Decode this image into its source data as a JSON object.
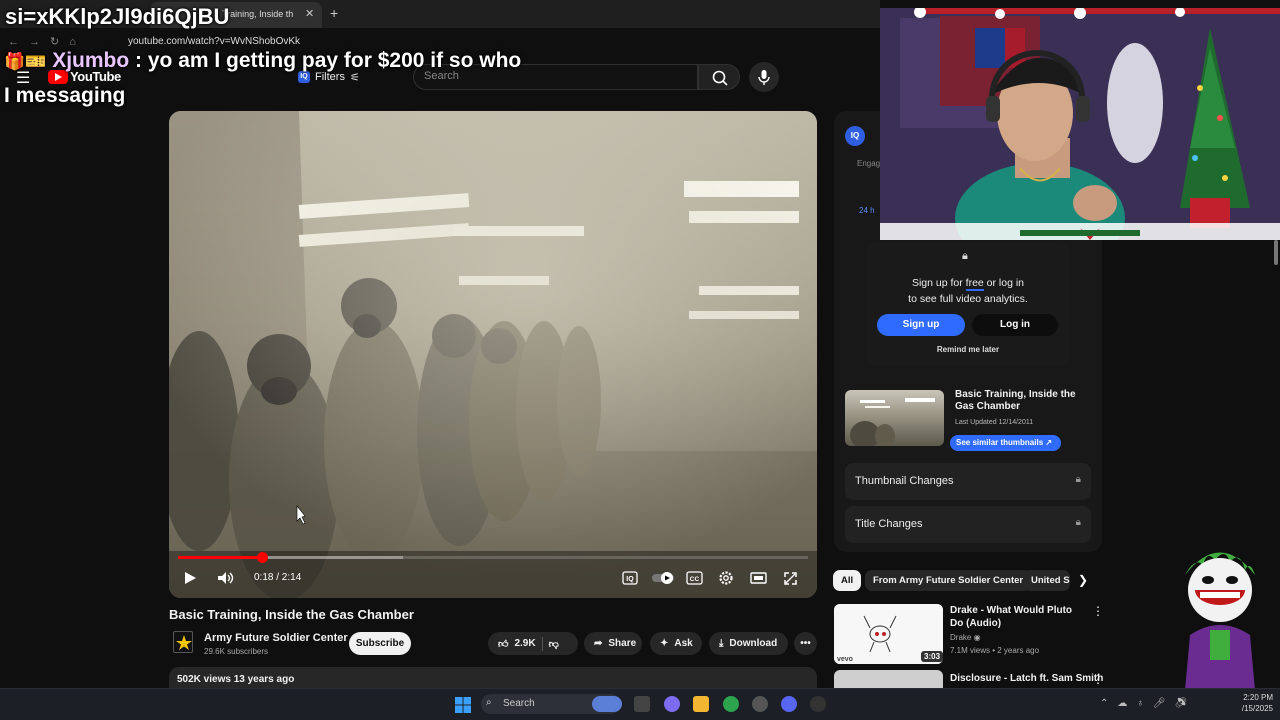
{
  "browser": {
    "tab_title": "Training, Inside th",
    "new_tab": "+",
    "tab_close": "✕",
    "url": "youtube.com/watch?v=WvNShobOvKk"
  },
  "overlay": {
    "title": "si=xKKlp2Jl9di6QjBU",
    "chat_badges": "🎁🎫",
    "chat_user": "Xjumbo",
    "chat_message": " : yo am I getting pay for $200 if so who I messaging"
  },
  "header": {
    "logo_text": "YouTube",
    "filters_label": "Filters",
    "search_placeholder": "Search"
  },
  "player": {
    "time": "0:18 / 2:14",
    "progress": 0.134
  },
  "video": {
    "title": "Basic Training, Inside the Gas Chamber",
    "channel": "Army Future Soldier Center",
    "subscribers": "29.6K subscribers",
    "subscribe_label": "Subscribe",
    "likes": "2.9K",
    "share_label": "Share",
    "ask_label": "Ask",
    "download_label": "Download",
    "views_label": "502K views  13 years ago"
  },
  "analytics": {
    "logo": "IQ",
    "engage_label": "Engag",
    "range_label": "24 h",
    "signup_prompt_1": "Sign up for ",
    "signup_free": "free",
    "signup_prompt_2": " or log in",
    "signup_prompt_3": "to see full video analytics.",
    "signup_button": "Sign up",
    "login_button": "Log in",
    "remind_label": "Remind me later",
    "thumb_title": "Basic Training, Inside the Gas Chamber",
    "thumb_updated": "Last Updated 12/14/2011",
    "similar_button": "See similar thumbnails ↗",
    "thumbnail_changes": "Thumbnail Changes",
    "title_changes": "Title Changes"
  },
  "chips": [
    "All",
    "From Army Future Soldier Center",
    "United S"
  ],
  "recommendations": [
    {
      "title": "Drake - What Would Pluto Do (Audio)",
      "channel": "Drake",
      "meta": "7.1M views • 2 years ago",
      "duration": "3:03",
      "badge": "vevo"
    },
    {
      "title": "Disclosure - Latch ft. Sam Smith"
    }
  ],
  "taskbar": {
    "search_label": "Search",
    "time": "2:20 PM",
    "date": "/15/2025"
  },
  "colors": {
    "accent_red": "#ff0000",
    "iq_blue": "#2f6bff",
    "background": "#0f0f0f"
  }
}
